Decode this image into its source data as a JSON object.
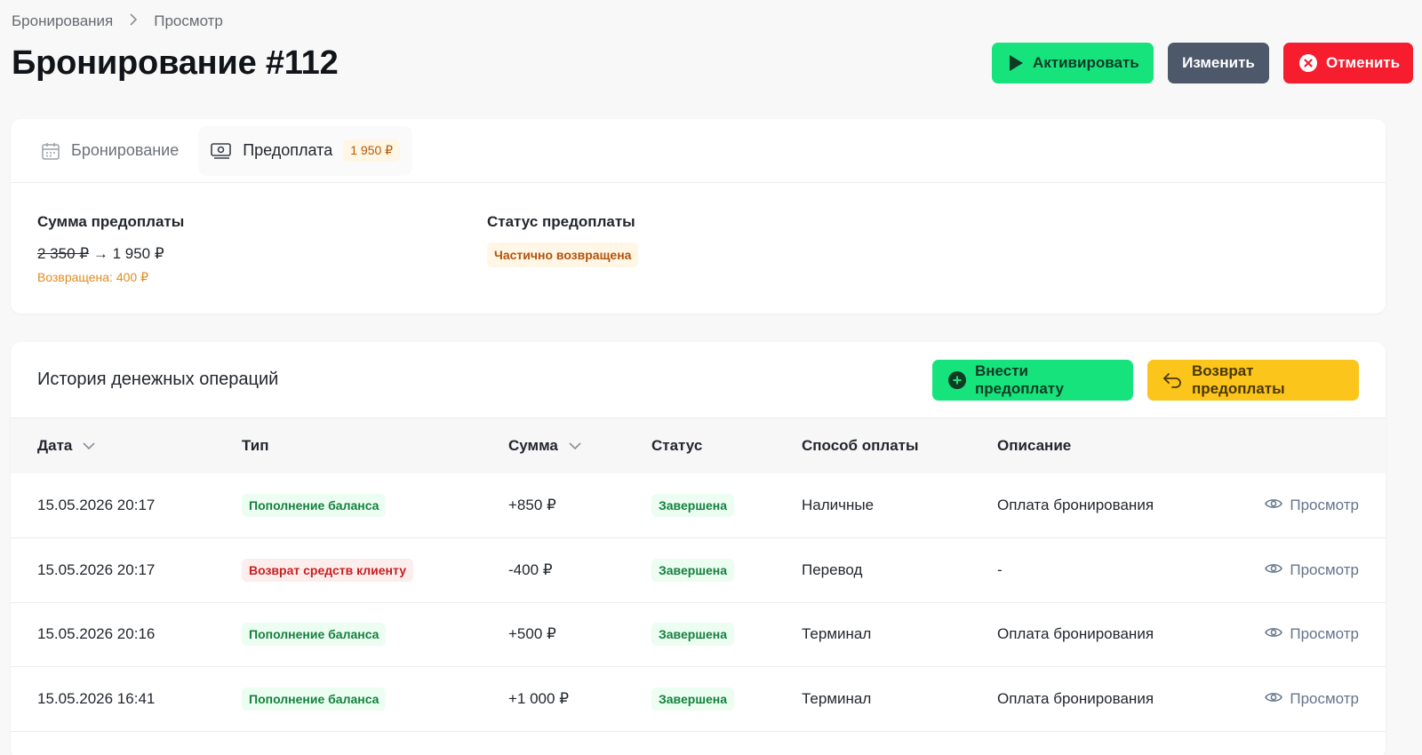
{
  "breadcrumb": {
    "root": "Бронирования",
    "current": "Просмотр"
  },
  "page": {
    "title": "Бронирование #112"
  },
  "actions": {
    "activate": "Активировать",
    "edit": "Изменить",
    "cancel": "Отменить"
  },
  "tabs": {
    "booking": "Бронирование",
    "prepay": "Предоплата",
    "prepay_badge": "1 950 ₽"
  },
  "summary": {
    "amount_label": "Сумма предоплаты",
    "amount_old": "2 350 ₽",
    "arrow": "→",
    "amount_new": "1 950 ₽",
    "refunded": "Возвращена: 400 ₽",
    "status_label": "Статус предоплаты",
    "status_value": "Частично возвращена"
  },
  "history": {
    "title": "История денежных операций",
    "deposit_button": "Внести предоплату",
    "refund_button": "Возврат предоплаты",
    "columns": {
      "date": "Дата",
      "type": "Тип",
      "amount": "Сумма",
      "status": "Статус",
      "method": "Способ оплаты",
      "description": "Описание"
    },
    "rows": [
      {
        "date": "15.05.2026 20:17",
        "type": "Пополнение баланса",
        "amount": "+850 ₽",
        "status": "Завершена",
        "method": "Наличные",
        "description": "Оплата бронирования",
        "action": "Просмотр"
      },
      {
        "date": "15.05.2026 20:17",
        "type": "Возврат средств клиенту",
        "amount": "-400 ₽",
        "status": "Завершена",
        "method": "Перевод",
        "description": "-",
        "action": "Просмотр"
      },
      {
        "date": "15.05.2026 20:16",
        "type": "Пополнение баланса",
        "amount": "+500 ₽",
        "status": "Завершена",
        "method": "Терминал",
        "description": "Оплата бронирования",
        "action": "Просмотр"
      },
      {
        "date": "15.05.2026 16:41",
        "type": "Пополнение баланса",
        "amount": "+1 000 ₽",
        "status": "Завершена",
        "method": "Терминал",
        "description": "Оплата бронирования",
        "action": "Просмотр"
      }
    ]
  },
  "colors": {
    "green": "#17e37d",
    "slate": "#4d596b",
    "red": "#f51d2e",
    "yellow": "#fbc51c",
    "orange_text": "#e38a1f"
  },
  "icons": {
    "activate": "play-icon",
    "cancel": "close-circle-icon",
    "booking_tab": "calendar-icon",
    "prepay_tab": "cash-icon",
    "sort": "chevron-down-icon",
    "deposit": "plus-circle-icon",
    "refund": "return-arrow-icon",
    "view": "eye-icon"
  }
}
